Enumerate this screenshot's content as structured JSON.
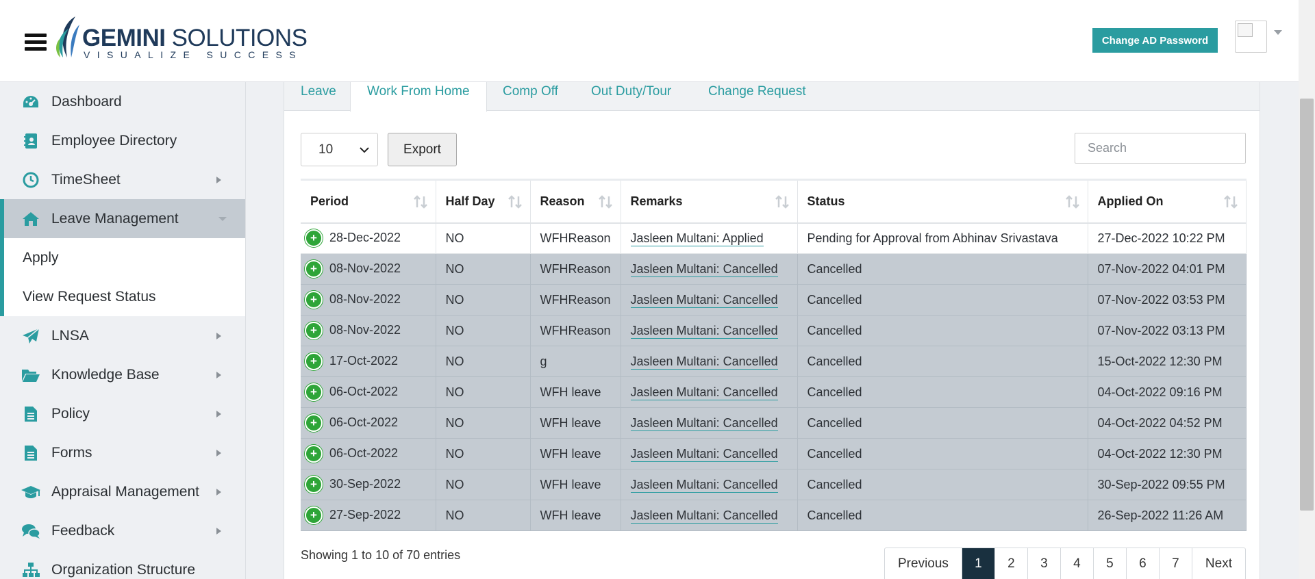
{
  "header": {
    "brand_name_bold": "GEMINI",
    "brand_name_light": " SOLUTIONS",
    "brand_tagline": "VISUALIZE SUCCESS",
    "change_password_label": "Change AD Password"
  },
  "sidebar": {
    "items": [
      {
        "label": "Dashboard",
        "icon": "dashboard-icon"
      },
      {
        "label": "Employee Directory",
        "icon": "contacts-book-icon"
      },
      {
        "label": "TimeSheet",
        "icon": "clock-icon"
      },
      {
        "label": "Leave Management",
        "icon": "home-icon"
      },
      {
        "label": "LNSA",
        "icon": "paper-plane-icon"
      },
      {
        "label": "Knowledge Base",
        "icon": "folder-open-icon"
      },
      {
        "label": "Policy",
        "icon": "document-icon"
      },
      {
        "label": "Forms",
        "icon": "document-icon"
      },
      {
        "label": "Appraisal Management",
        "icon": "graduation-cap-icon"
      },
      {
        "label": "Feedback",
        "icon": "chat-bubbles-icon"
      },
      {
        "label": "Organization Structure",
        "icon": "sitemap-icon"
      }
    ],
    "sub_items": [
      "Apply",
      "View Request Status"
    ]
  },
  "tabs": [
    "Leave",
    "Work From Home",
    "Comp Off",
    "Out Duty/Tour",
    "Change Request"
  ],
  "active_tab": "Work From Home",
  "controls": {
    "page_length": "10",
    "export_label": "Export",
    "search_placeholder": "Search"
  },
  "table": {
    "columns": [
      "Period",
      "Half Day",
      "Reason",
      "Remarks",
      "Status",
      "Applied On"
    ],
    "rows": [
      {
        "period": "28-Dec-2022",
        "half_day": "NO",
        "reason": "WFHReason",
        "remarks": "Jasleen Multani: Applied",
        "status": "Pending for Approval from Abhinav Srivastava",
        "applied_on": "27-Dec-2022 10:22 PM"
      },
      {
        "period": "08-Nov-2022",
        "half_day": "NO",
        "reason": "WFHReason",
        "remarks": "Jasleen Multani: Cancelled",
        "status": "Cancelled",
        "applied_on": "07-Nov-2022 04:01 PM"
      },
      {
        "period": "08-Nov-2022",
        "half_day": "NO",
        "reason": "WFHReason",
        "remarks": "Jasleen Multani: Cancelled",
        "status": "Cancelled",
        "applied_on": "07-Nov-2022 03:53 PM"
      },
      {
        "period": "08-Nov-2022",
        "half_day": "NO",
        "reason": "WFHReason",
        "remarks": "Jasleen Multani: Cancelled",
        "status": "Cancelled",
        "applied_on": "07-Nov-2022 03:13 PM"
      },
      {
        "period": "17-Oct-2022",
        "half_day": "NO",
        "reason": "g",
        "remarks": "Jasleen Multani: Cancelled",
        "status": "Cancelled",
        "applied_on": "15-Oct-2022 12:30 PM"
      },
      {
        "period": "06-Oct-2022",
        "half_day": "NO",
        "reason": "WFH leave",
        "remarks": "Jasleen Multani: Cancelled",
        "status": "Cancelled",
        "applied_on": "04-Oct-2022 09:16 PM"
      },
      {
        "period": "06-Oct-2022",
        "half_day": "NO",
        "reason": "WFH leave",
        "remarks": "Jasleen Multani: Cancelled",
        "status": "Cancelled",
        "applied_on": "04-Oct-2022 04:52 PM"
      },
      {
        "period": "06-Oct-2022",
        "half_day": "NO",
        "reason": "WFH leave",
        "remarks": "Jasleen Multani: Cancelled",
        "status": "Cancelled",
        "applied_on": "04-Oct-2022 12:30 PM"
      },
      {
        "period": "30-Sep-2022",
        "half_day": "NO",
        "reason": "WFH leave",
        "remarks": "Jasleen Multani: Cancelled",
        "status": "Cancelled",
        "applied_on": "30-Sep-2022 09:55 PM"
      },
      {
        "period": "27-Sep-2022",
        "half_day": "NO",
        "reason": "WFH leave",
        "remarks": "Jasleen Multani: Cancelled",
        "status": "Cancelled",
        "applied_on": "26-Sep-2022 11:26 AM"
      }
    ]
  },
  "footer": {
    "info": "Showing 1 to 10 of 70 entries",
    "previous_label": "Previous",
    "pages": [
      "1",
      "2",
      "3",
      "4",
      "5",
      "6",
      "7"
    ],
    "current_page": "1",
    "next_label": "Next"
  },
  "colors": {
    "accent": "#2a9ca0",
    "active_row_bg": "#c4cbd2",
    "current_page_bg": "#19303f",
    "expand_green": "#2ea538"
  }
}
